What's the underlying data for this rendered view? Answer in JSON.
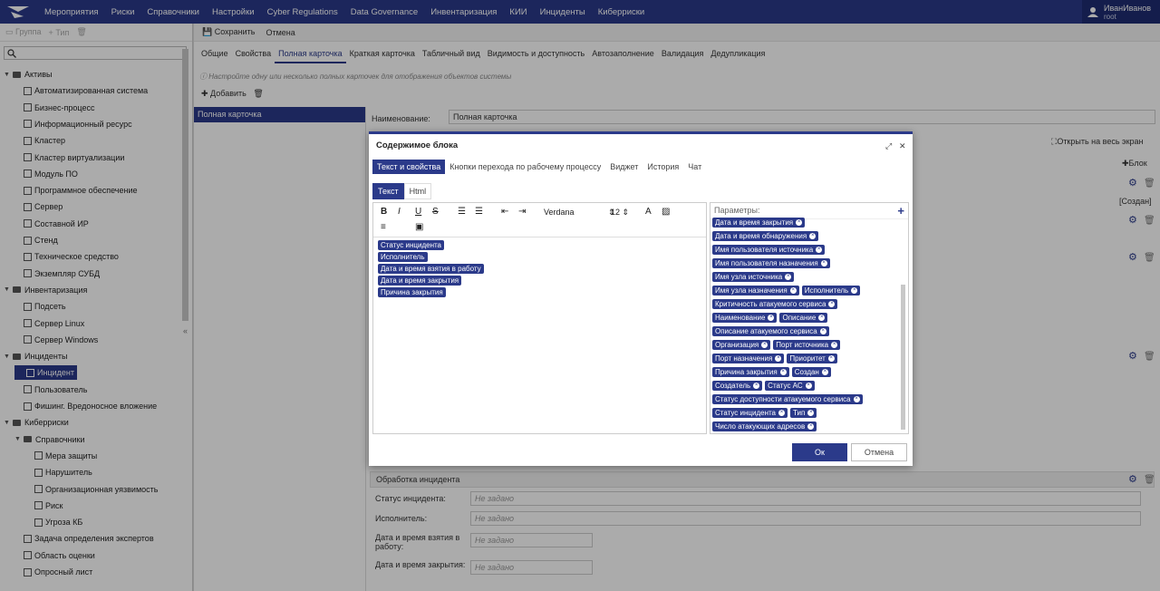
{
  "topbar": {
    "menu": [
      "Мероприятия",
      "Риски",
      "Справочники",
      "Настройки",
      "Cyber Regulations",
      "Data Governance",
      "Инвентаризация",
      "КИИ",
      "Инциденты",
      "Киберриски"
    ],
    "user_name": "ИванИванов",
    "user_role": "root"
  },
  "left": {
    "toolbar": {
      "group": "Группа",
      "type": "Тип"
    },
    "tree": [
      {
        "label": "Активы",
        "level": 0,
        "kind": "folder"
      },
      {
        "label": "Автоматизированная система",
        "level": 1,
        "kind": "node"
      },
      {
        "label": "Бизнес-процесс",
        "level": 1,
        "kind": "node"
      },
      {
        "label": "Информационный ресурс",
        "level": 1,
        "kind": "node"
      },
      {
        "label": "Кластер",
        "level": 1,
        "kind": "node"
      },
      {
        "label": "Кластер виртуализации",
        "level": 1,
        "kind": "node"
      },
      {
        "label": "Модуль ПО",
        "level": 1,
        "kind": "node"
      },
      {
        "label": "Программное обеспечение",
        "level": 1,
        "kind": "node"
      },
      {
        "label": "Сервер",
        "level": 1,
        "kind": "node"
      },
      {
        "label": "Составной ИР",
        "level": 1,
        "kind": "node"
      },
      {
        "label": "Стенд",
        "level": 1,
        "kind": "node"
      },
      {
        "label": "Техническое средство",
        "level": 1,
        "kind": "node"
      },
      {
        "label": "Экземпляр СУБД",
        "level": 1,
        "kind": "node"
      },
      {
        "label": "Инвентаризация",
        "level": 0,
        "kind": "folder"
      },
      {
        "label": "Подсеть",
        "level": 1,
        "kind": "node"
      },
      {
        "label": "Сервер Linux",
        "level": 1,
        "kind": "node"
      },
      {
        "label": "Сервер Windows",
        "level": 1,
        "kind": "node"
      },
      {
        "label": "Инциденты",
        "level": 0,
        "kind": "folder"
      },
      {
        "label": "Инцидент",
        "level": 1,
        "kind": "node",
        "selected": true
      },
      {
        "label": "Пользователь",
        "level": 1,
        "kind": "node"
      },
      {
        "label": "Фишинг. Вредоносное вложение",
        "level": 1,
        "kind": "node"
      },
      {
        "label": "Киберриски",
        "level": 0,
        "kind": "folder"
      },
      {
        "label": "Справочники",
        "level": 1,
        "kind": "folder"
      },
      {
        "label": "Мера защиты",
        "level": 2,
        "kind": "node"
      },
      {
        "label": "Нарушитель",
        "level": 2,
        "kind": "node"
      },
      {
        "label": "Организационная уязвимость",
        "level": 2,
        "kind": "node"
      },
      {
        "label": "Риск",
        "level": 2,
        "kind": "node"
      },
      {
        "label": "Угроза КБ",
        "level": 2,
        "kind": "node"
      },
      {
        "label": "Задача определения экспертов",
        "level": 1,
        "kind": "node"
      },
      {
        "label": "Область оценки",
        "level": 1,
        "kind": "node"
      },
      {
        "label": "Опросный лист",
        "level": 1,
        "kind": "node"
      }
    ]
  },
  "main": {
    "toolbar": {
      "save": "Сохранить",
      "cancel": "Отмена"
    },
    "tabs": [
      "Общие",
      "Свойства",
      "Полная карточка",
      "Краткая карточка",
      "Табличный вид",
      "Видимость и доступность",
      "Автозаполнение",
      "Валидация",
      "Дедупликация"
    ],
    "active_tab": "Полная карточка",
    "info": "Настройте одну или несколько полных карточек для отображения объектов системы",
    "add": "Добавить",
    "card_item": "Полная карточка",
    "name_label": "Наименование:",
    "name_value": "Полная карточка",
    "fullscreen": "Открыть на весь экран",
    "block": "Блок",
    "created": "[Создан]",
    "section_title": "Обработка инцидента",
    "fields": [
      {
        "label": "Статус инцидента:",
        "placeholder": "Не задано"
      },
      {
        "label": "Исполнитель:",
        "placeholder": "Не задано"
      },
      {
        "label": "Дата и время взятия в работу:",
        "placeholder": "Не задано"
      },
      {
        "label": "Дата и время закрытия:",
        "placeholder": "Не задано"
      }
    ]
  },
  "modal": {
    "title": "Содержимое блока",
    "tabs": [
      "Текст и свойства",
      "Кнопки перехода по рабочему процессу",
      "Виджет",
      "История",
      "Чат"
    ],
    "subtabs": [
      "Текст",
      "Html"
    ],
    "font": "Verdana",
    "size": "12",
    "content_tags": [
      "Статус инцидента",
      "Исполнитель",
      "Дата и время взятия в работу",
      "Дата и время закрытия",
      "Причина закрытия"
    ],
    "params_label": "Параметры:",
    "param_rows": [
      [
        "Дата и время закрытия"
      ],
      [
        "Дата и время обнаружения"
      ],
      [
        "Имя пользователя источника"
      ],
      [
        "Имя пользователя назначения"
      ],
      [
        "Имя узла источника"
      ],
      [
        "Имя узла назначения",
        "Исполнитель"
      ],
      [
        "Критичность атакуемого сервиса"
      ],
      [
        "Наименование",
        "Описание"
      ],
      [
        "Описание атакуемого сервиса"
      ],
      [
        "Организация",
        "Порт источника"
      ],
      [
        "Порт назначения",
        "Приоритет"
      ],
      [
        "Причина закрытия",
        "Создан"
      ],
      [
        "Создатель",
        "Статус АС"
      ],
      [
        "Статус доступности атакуемого сервиса"
      ],
      [
        "Статус инцидента",
        "Тип"
      ],
      [
        "Число атакующих адресов"
      ]
    ],
    "ok": "Ок",
    "cancel": "Отмена"
  }
}
